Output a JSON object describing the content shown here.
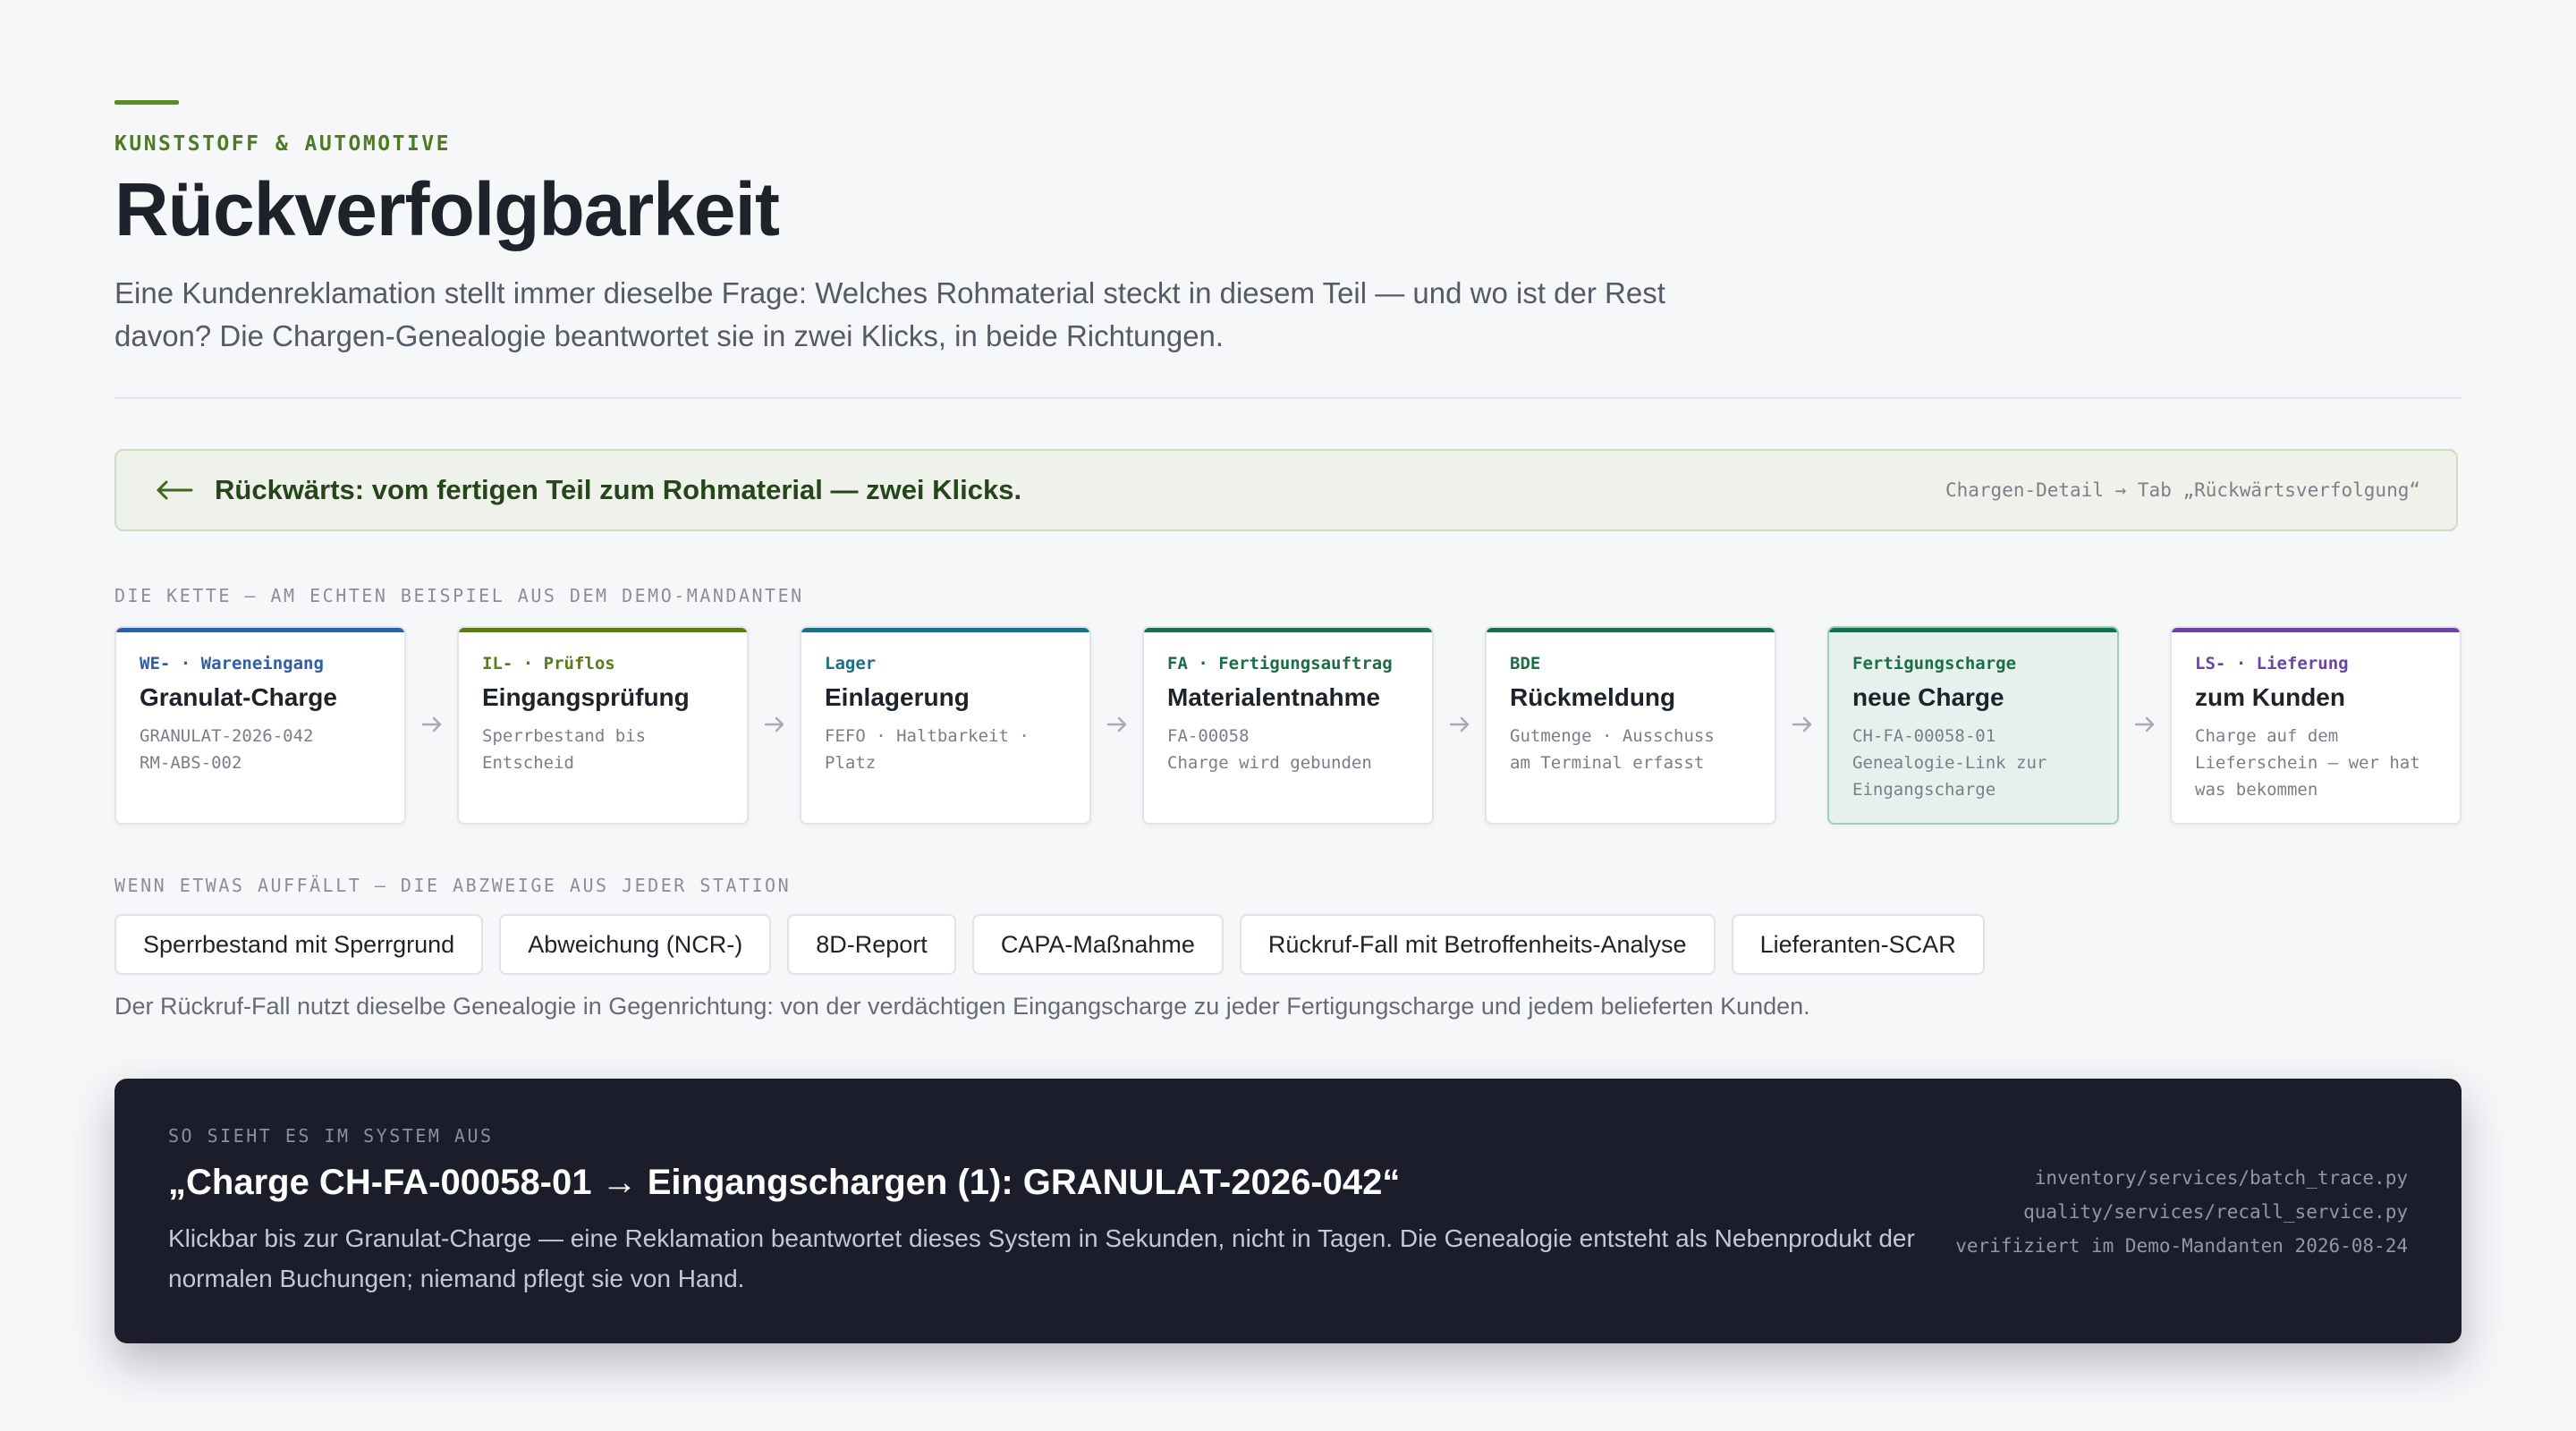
{
  "header": {
    "eyebrow": "KUNSTSTOFF & AUTOMOTIVE",
    "title": "Rückverfolgbarkeit",
    "lead": "Eine Kundenreklamation stellt immer dieselbe Frage: Welches Rohmaterial steckt in diesem Teil — und wo ist der Rest davon? Die Chargen-Genealogie beantwortet sie in zwei Klicks, in beide Richtungen."
  },
  "banner": {
    "icon": "arrow-left-icon",
    "text": "Rückwärts: vom fertigen Teil zum Rohmaterial — zwei Klicks.",
    "meta": "Chargen-Detail → Tab „Rückwärtsverfolgung“"
  },
  "chain": {
    "label": "DIE KETTE — AM ECHTEN BEISPIEL AUS DEM DEMO-MANDANTEN",
    "cards": [
      {
        "tag": "WE- · Wareneingang",
        "title": "Granulat-Charge",
        "desc": "GRANULAT-2026-042\nRM-ABS-002",
        "color": "#2f5ea8",
        "highlight": false
      },
      {
        "tag": "IL- · Prüflos",
        "title": "Eingangsprüfung",
        "desc": "Sperrbestand bis\nEntscheid",
        "color": "#5a7a1c",
        "highlight": false
      },
      {
        "tag": "Lager",
        "title": "Einlagerung",
        "desc": "FEFO · Haltbarkeit ·\nPlatz",
        "color": "#1d6f85",
        "highlight": false
      },
      {
        "tag": "FA · Fertigungsauftrag",
        "title": "Materialentnahme",
        "desc": "FA-00058\nCharge wird gebunden",
        "color": "#1b6e46",
        "highlight": false
      },
      {
        "tag": "BDE",
        "title": "Rückmeldung",
        "desc": "Gutmenge · Ausschuss\nam Terminal erfasst",
        "color": "#1b6e46",
        "highlight": false
      },
      {
        "tag": "Fertigungscharge",
        "title": "neue Charge",
        "desc": "CH-FA-00058-01\nGenealogie-Link zur\nEingangscharge",
        "color": "#1b6e46",
        "highlight": true
      },
      {
        "tag": "LS- · Lieferung",
        "title": "zum Kunden",
        "desc": "Charge auf dem\nLieferschein — wer hat\nwas bekommen",
        "color": "#6b45a3",
        "highlight": false
      }
    ]
  },
  "branches": {
    "label": "WENN ETWAS AUFFÄLLT — DIE ABZWEIGE AUS JEDER STATION",
    "chips": [
      "Sperrbestand mit Sperrgrund",
      "Abweichung (NCR-)",
      "8D-Report",
      "CAPA-Maßnahme",
      "Rückruf-Fall mit Betroffenheits-Analyse",
      "Lieferanten-SCAR"
    ],
    "note": "Der Rückruf-Fall nutzt dieselbe Genealogie in Gegenrichtung: von der verdächtigen Eingangscharge zu jeder Fertigungscharge und jedem belieferten Kunden."
  },
  "system": {
    "label": "SO SIEHT ES IM SYSTEM AUS",
    "title": "„Charge CH-FA-00058-01 → Eingangschargen (1): GRANULAT-2026-042“",
    "body": "Klickbar bis zur Granulat-Charge — eine Reklamation beantwortet dieses System in Sekunden, nicht in Tagen. Die Genealogie entsteht als Nebenprodukt der normalen Buchungen; niemand pflegt sie von Hand.",
    "meta": [
      "inventory/services/batch_trace.py",
      "quality/services/recall_service.py",
      "verifiziert im Demo-Mandanten 2026-08-24"
    ]
  },
  "colors": {
    "accent": "#5a8a2c",
    "dark_panel": "#1b1e2a",
    "highlight_card": "#e6f1ee"
  }
}
